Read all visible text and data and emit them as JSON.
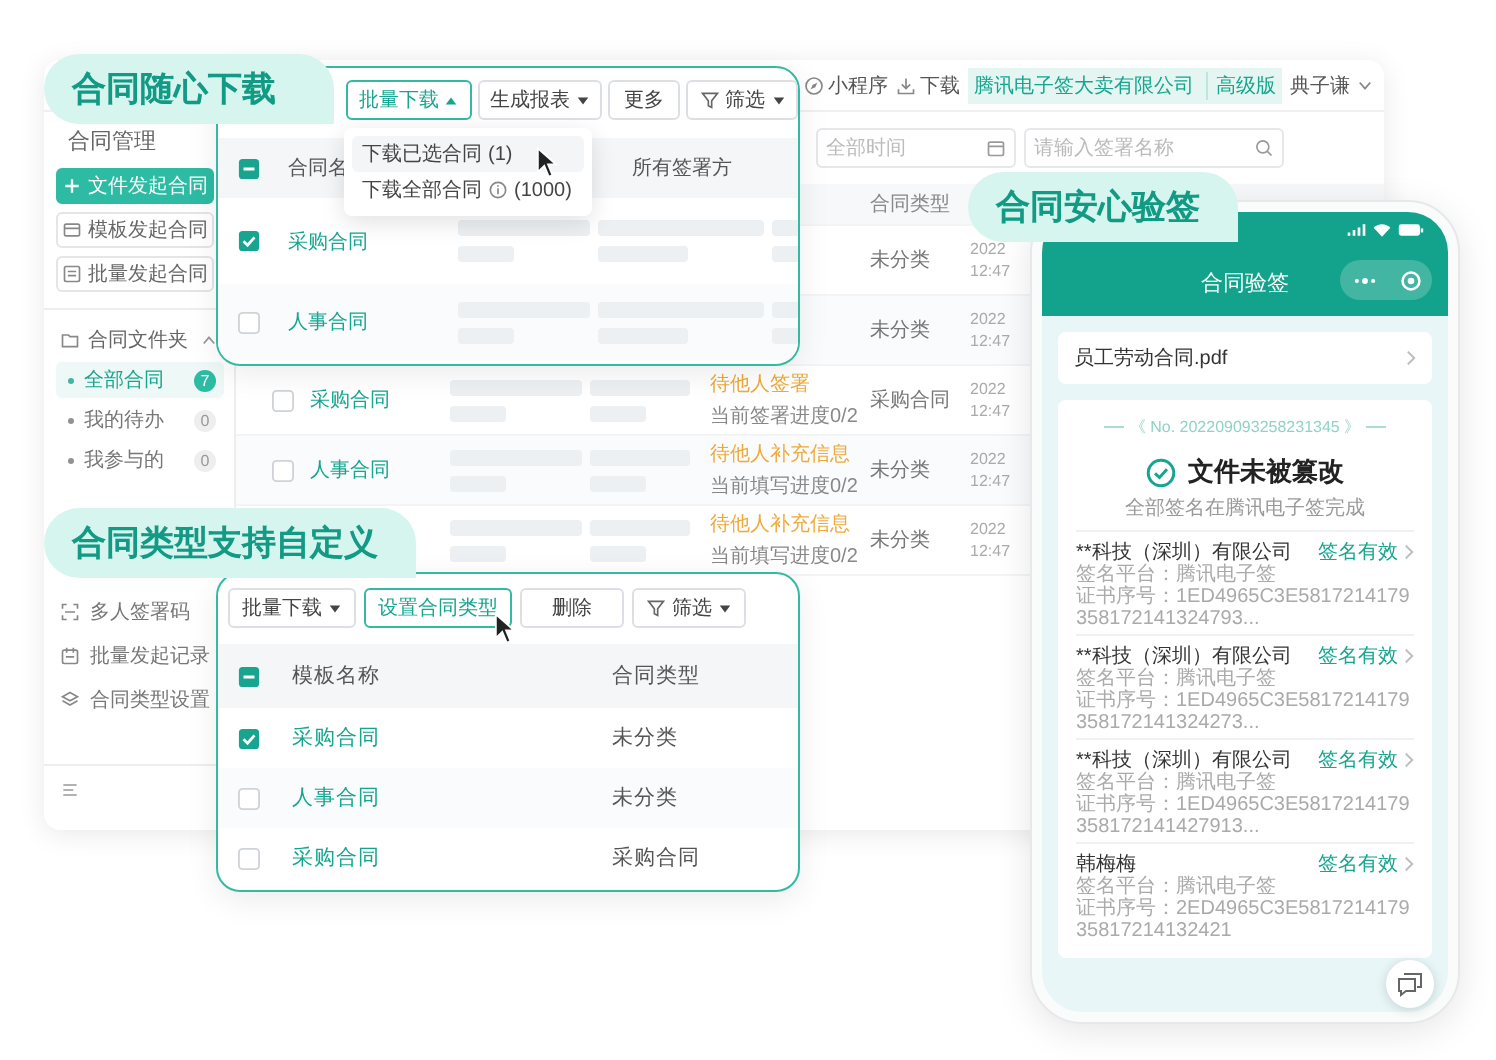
{
  "app": {
    "topbar": {
      "items": [
        {
          "kind": "miniprogram",
          "label": "小程序"
        },
        {
          "kind": "download",
          "label": "下载"
        }
      ],
      "company": "腾讯电子签大卖有限公司",
      "plan": "高级版",
      "user": "典子谦"
    },
    "sidebar": {
      "title": "合同管理",
      "actions": [
        {
          "kind": "primary",
          "label": "文件发起合同"
        },
        {
          "kind": "template",
          "label": "模板发起合同"
        },
        {
          "kind": "batch",
          "label": "批量发起合同"
        }
      ],
      "folder": {
        "label": "合同文件夹",
        "expanded": true,
        "children": [
          {
            "label": "全部合同",
            "count": "7",
            "selected": true
          },
          {
            "label": "我的待办",
            "count": "0",
            "selected": false
          },
          {
            "label": "我参与的",
            "count": "0",
            "selected": false
          }
        ]
      },
      "tools": [
        {
          "kind": "qrcode",
          "label": "多人签署码"
        },
        {
          "kind": "record",
          "label": "批量发起记录"
        },
        {
          "kind": "settings",
          "label": "合同类型设置"
        }
      ]
    },
    "filters": {
      "date_placeholder": "全部时间",
      "search_placeholder": "请输入签署名称"
    },
    "table": {
      "type_header": "合同类型",
      "rows": [
        {
          "type": "未分类",
          "date": "2022",
          "time": "12:47"
        },
        {
          "type": "未分类",
          "date": "2022",
          "time": "12:47"
        },
        {
          "checked": false,
          "name": "采购合同",
          "status": "待他人签署",
          "progress": "当前签署进度0/2",
          "type": "采购合同",
          "date": "2022",
          "time": "12:47"
        },
        {
          "checked": false,
          "name": "人事合同",
          "status": "待他人补充信息",
          "progress": "当前填写进度0/2",
          "type": "未分类",
          "date": "2022",
          "time": "12:47"
        },
        {
          "status": "待他人补充信息",
          "progress": "当前填写进度0/2",
          "type": "未分类",
          "date": "2022",
          "time": "12:47"
        }
      ]
    }
  },
  "download_panel": {
    "tag": "合同随心下载",
    "toolbar": [
      {
        "kind": "dropdown",
        "label": "批量下载",
        "active": true,
        "open": true
      },
      {
        "kind": "dropdown",
        "label": "生成报表",
        "active": false,
        "open": false
      },
      {
        "kind": "plain",
        "label": "更多",
        "active": false
      },
      {
        "kind": "filter",
        "label": "筛选",
        "active": false,
        "open": false
      }
    ],
    "menu": [
      {
        "label": "下载已选合同",
        "count": "(1)",
        "info": false,
        "hovered": true
      },
      {
        "label": "下载全部合同",
        "count": "(1000)",
        "info": true,
        "hovered": false
      }
    ],
    "header_checkbox": {
      "indeterminate": true
    },
    "columns": [
      "合同名",
      "所有签署方"
    ],
    "rows": [
      {
        "name": "采购合同",
        "checked": true
      },
      {
        "name": "人事合同",
        "checked": false
      }
    ]
  },
  "type_panel": {
    "tag": "合同类型支持自定义",
    "toolbar": [
      {
        "kind": "dropdown",
        "label": "批量下载",
        "active": false,
        "open": false
      },
      {
        "kind": "plain",
        "label": "设置合同类型",
        "active": true
      },
      {
        "kind": "plain",
        "label": "删除",
        "active": false
      },
      {
        "kind": "filter",
        "label": "筛选",
        "active": false,
        "open": false
      }
    ],
    "header_checkbox": {
      "indeterminate": true
    },
    "columns": [
      "模板名称",
      "合同类型"
    ],
    "rows": [
      {
        "name": "采购合同",
        "type": "未分类",
        "checked": true
      },
      {
        "name": "人事合同",
        "type": "未分类",
        "checked": false
      },
      {
        "name": "采购合同",
        "type": "采购合同",
        "checked": false
      }
    ]
  },
  "verify": {
    "tag": "合同安心验签",
    "title": "合同验签",
    "file": "员工劳动合同.pdf",
    "serial": "《 No. 202209093258231345 》",
    "result_ok": true,
    "result": "文件未被篡改",
    "note": "全部签名在腾讯电子签完成",
    "signers": [
      {
        "name": "**科技（深圳）有限公司",
        "status": "签名有效",
        "platform": "签名平台：腾讯电子签",
        "cert": "证书序号：1ED4965C3E5817214179358172141324793..."
      },
      {
        "name": "**科技（深圳）有限公司",
        "status": "签名有效",
        "platform": "签名平台：腾讯电子签",
        "cert": "证书序号：1ED4965C3E5817214179358172141324273..."
      },
      {
        "name": "**科技（深圳）有限公司",
        "status": "签名有效",
        "platform": "签名平台：腾讯电子签",
        "cert": "证书序号：1ED4965C3E5817214179358172141427913..."
      },
      {
        "name": "韩梅梅",
        "status": "签名有效",
        "platform": "签名平台：腾讯电子签",
        "cert": "证书序号：2ED4965C3E581721417935817214132421"
      }
    ]
  }
}
